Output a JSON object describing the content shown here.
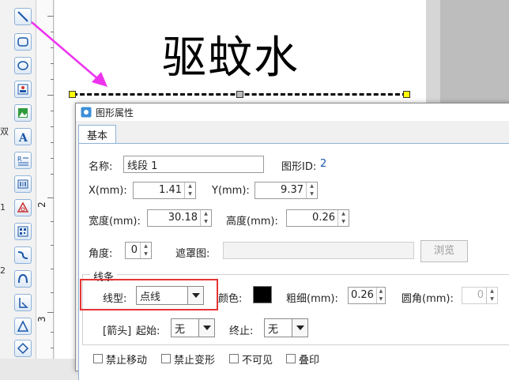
{
  "edge_labels": [
    "双",
    "1",
    "2"
  ],
  "ruler": {
    "marks": [
      "2",
      "3"
    ]
  },
  "canvas": {
    "label_text": "驱蚊水"
  },
  "dialog": {
    "title": "图形属性",
    "tab_basic": "基本",
    "name_label": "名称:",
    "name_value": "线段 1",
    "shape_id_label": "图形ID:",
    "shape_id_value": "2",
    "x_label": "X(mm):",
    "x_value": "1.41",
    "y_label": "Y(mm):",
    "y_value": "9.37",
    "width_label": "宽度(mm):",
    "width_value": "30.18",
    "height_label": "高度(mm):",
    "height_value": "0.26",
    "angle_label": "角度:",
    "angle_value": "0",
    "mask_label": "遮罩图:",
    "mask_value": "",
    "browse_label": "浏览",
    "line_group_label": "线条",
    "line_type_label": "线型:",
    "line_type_value": "点线",
    "color_label": "颜色:",
    "color_value": "#000000",
    "thickness_label": "粗细(mm):",
    "thickness_value": "0.26",
    "corner_label": "圆角(mm):",
    "corner_value": "0",
    "arrow_label": "[箭头]",
    "arrow_start_label": "起始:",
    "arrow_start_value": "无",
    "arrow_end_label": "终止:",
    "arrow_end_value": "无",
    "checkboxes": [
      "禁止移动",
      "禁止变形",
      "不可见",
      "叠印"
    ]
  },
  "colors": {
    "highlight": "#e53535",
    "pointer_arrow": "#ee33ee",
    "handle_yellow": "#ffff00",
    "handle_gray": "#bdbdbd",
    "accent": "#1a56a8"
  }
}
